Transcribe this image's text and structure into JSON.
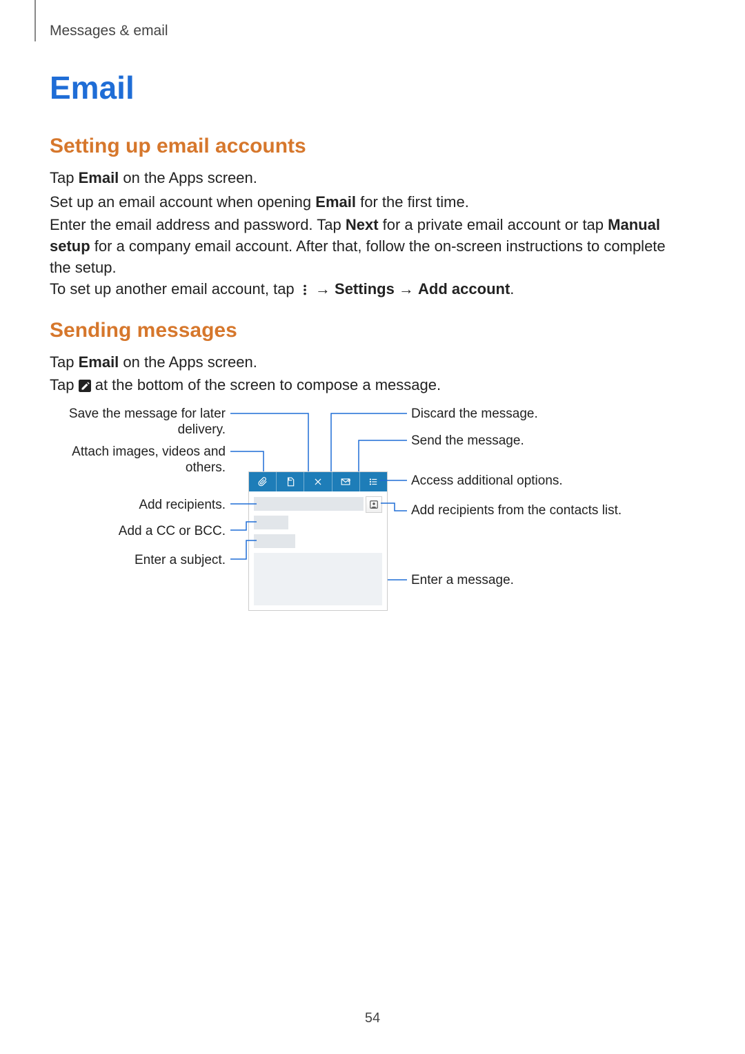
{
  "breadcrumb": "Messages & email",
  "page_number": "54",
  "headings": {
    "h1": "Email",
    "h2_setup": "Setting up email accounts",
    "h2_sending": "Sending messages"
  },
  "paragraphs": {
    "p1_pre": "Tap ",
    "p1_b": "Email",
    "p1_post": " on the Apps screen.",
    "p2_pre": "Set up an email account when opening ",
    "p2_b": "Email",
    "p2_post": " for the first time.",
    "p3_pre": "Enter the email address and password. Tap ",
    "p3_b1": "Next",
    "p3_mid": " for a private email account or tap ",
    "p3_b2": "Manual setup",
    "p3_post": " for a company email account. After that, follow the on-screen instructions to complete the setup.",
    "p4_pre": "To set up another email account, tap ",
    "p4_arrow1": " → ",
    "p4_b1": "Settings",
    "p4_arrow2": " → ",
    "p4_b2": "Add account",
    "p4_post": ".",
    "p5_pre": "Tap ",
    "p5_b": "Email",
    "p5_post": " on the Apps screen.",
    "p6_pre": "Tap ",
    "p6_post": " at the bottom of the screen to compose a message."
  },
  "callouts": {
    "left": {
      "save": "Save the message for later delivery.",
      "attach": "Attach images, videos and others.",
      "recipients": "Add recipients.",
      "ccbcc": "Add a CC or BCC.",
      "subject": "Enter a subject."
    },
    "right": {
      "discard": "Discard the message.",
      "send": "Send the message.",
      "options": "Access additional options.",
      "contacts": "Add recipients from the contacts list.",
      "body": "Enter a message."
    }
  },
  "icons": {
    "more": "more-vert-icon",
    "compose": "compose-icon",
    "attach": "paperclip-icon",
    "save": "save-draft-icon",
    "discard": "close-x-icon",
    "send": "send-envelope-icon",
    "options": "options-menu-icon",
    "contact": "contact-card-icon"
  }
}
